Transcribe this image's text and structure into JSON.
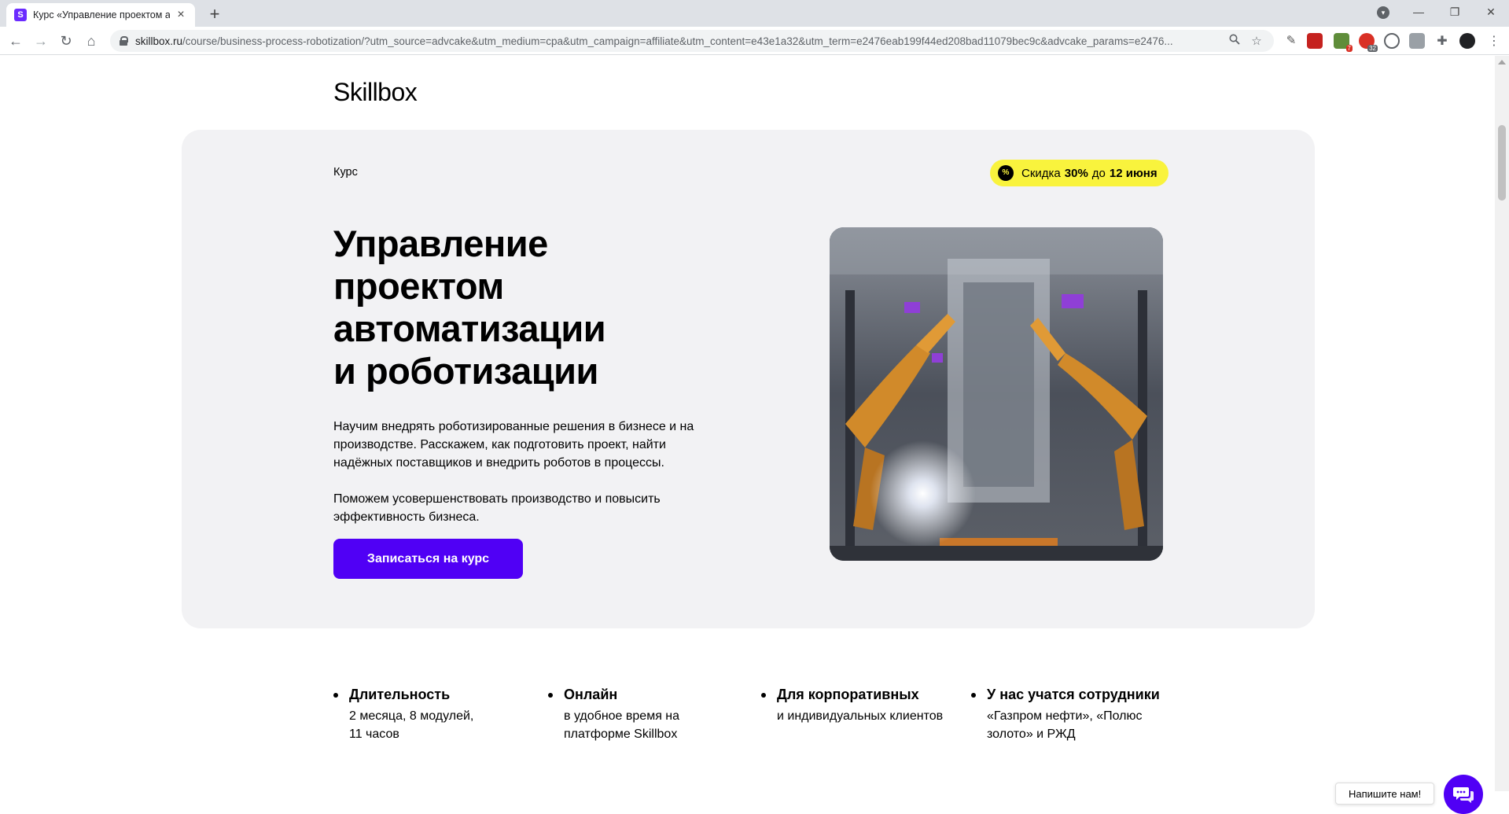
{
  "browser": {
    "tab_title": "Курс «Управление проектом ав",
    "favicon_letter": "S",
    "url_domain": "skillbox.ru",
    "url_rest": "/course/business-process-robotization/?utm_source=advcake&utm_medium=cpa&utm_campaign=affiliate&utm_content=e43e1a32&utm_term=e2476eab199f44ed208bad11079bec9c&advcake_params=e2476...",
    "ext_badge_1": "7",
    "ext_badge_2": "32"
  },
  "page": {
    "logo": "Skillbox",
    "hero": {
      "label": "Курс",
      "discount_prefix": "Скидка",
      "discount_value": "30%",
      "discount_mid": "до",
      "discount_date": "12 июня",
      "title_lines": [
        "Управление",
        "проектом",
        "автоматизации",
        "и роботизации"
      ],
      "description": "Научим внедрять роботизированные решения в бизнесе и на производстве. Расскажем, как подготовить проект, найти надёжных поставщиков и внедрить роботов в процессы.",
      "description2": "Поможем усовершенствовать производство и повысить эффективность бизнеса.",
      "cta": "Записаться на курс"
    },
    "features": [
      {
        "title": "Длительность",
        "text": "2 месяца, 8 модулей, 11 часов"
      },
      {
        "title": "Онлайн",
        "text": "в удобное время на платформе Skillbox"
      },
      {
        "title": "Для корпоративных",
        "text": "и индивидуальных клиентов"
      },
      {
        "title": "У нас учатся сотрудники",
        "text": "«Газпром нефти», «Полюс золото» и РЖД"
      }
    ],
    "chat_label": "Напишите нам!"
  },
  "colors": {
    "accent": "#5000f5",
    "discount_bg": "#f9f33d",
    "hero_bg": "#f2f2f4"
  }
}
